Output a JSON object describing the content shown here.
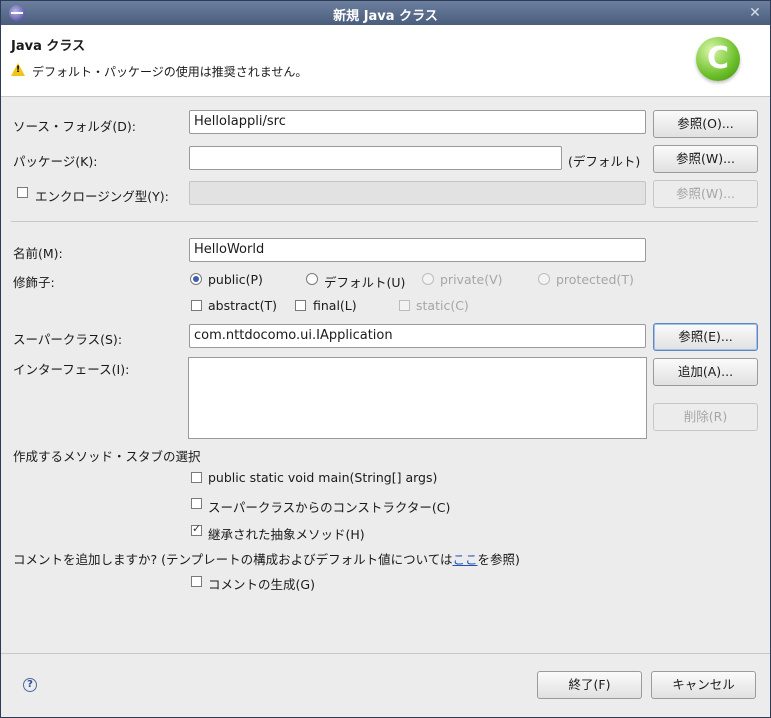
{
  "window": {
    "title": "新規 Java クラス",
    "close_glyph": "✕"
  },
  "banner": {
    "heading": "Java クラス",
    "warning": "デフォルト・パッケージの使用は推奨されません。",
    "logo_glyph": "C"
  },
  "source_folder": {
    "label": "ソース・フォルダ(D):",
    "value": "HelloIappli/src",
    "browse": "参照(O)..."
  },
  "package": {
    "label": "パッケージ(K):",
    "value": "",
    "suffix": "(デフォルト)",
    "browse": "参照(W)..."
  },
  "enclosing": {
    "label": "エンクロージング型(Y):",
    "value": "",
    "browse": "参照(W)...",
    "checked": false
  },
  "name": {
    "label": "名前(M):",
    "value": "HelloWorld"
  },
  "modifiers": {
    "label": "修飾子:",
    "public": "public(P)",
    "default": "デフォルト(U)",
    "private": "private(V)",
    "protected": "protected(T)",
    "abstract": "abstract(T)",
    "final": "final(L)",
    "static": "static(C)",
    "selected": "public"
  },
  "superclass": {
    "label": "スーパークラス(S):",
    "value": "com.nttdocomo.ui.IApplication",
    "browse": "参照(E)..."
  },
  "interfaces": {
    "label": "インターフェース(I):",
    "add": "追加(A)...",
    "remove": "削除(R)"
  },
  "stubs": {
    "label": "作成するメソッド・スタブの選択",
    "main": "public static void main(String[] args)",
    "constructors": "スーパークラスからのコンストラクター(C)",
    "inherited": "継承された抽象メソッド(H)",
    "main_checked": false,
    "constructors_checked": false,
    "inherited_checked": true
  },
  "comments": {
    "prefix": "コメントを追加しますか? (テンプレートの構成およびデフォルト値については",
    "link": "ここ",
    "suffix": "を参照)",
    "generate": "コメントの生成(G)",
    "checked": false
  },
  "footer": {
    "help_glyph": "?",
    "finish": "終了(F)",
    "cancel": "キャンセル"
  },
  "colors": {
    "titlebar": "#5a6d8c",
    "link": "#1f52b8",
    "logo": "#6cbf2a"
  }
}
